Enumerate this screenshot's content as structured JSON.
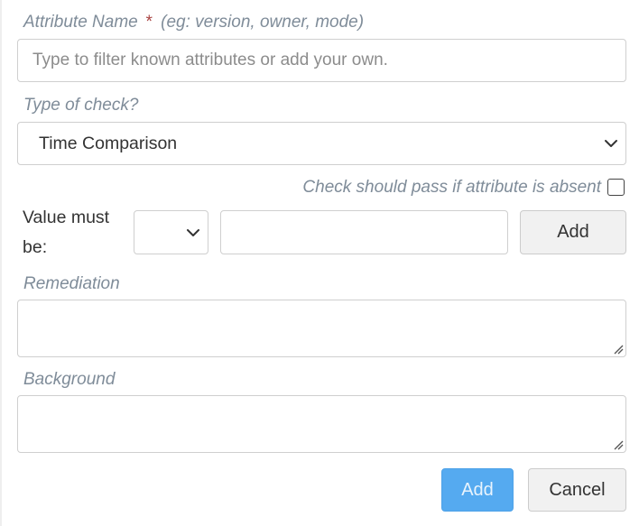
{
  "attribute_name": {
    "label": "Attribute Name",
    "required_mark": "*",
    "hint": "(eg: version, owner, mode)",
    "placeholder": "Type to filter known attributes or add your own.",
    "value": ""
  },
  "type_of_check": {
    "label": "Type of check?",
    "selected": "Time Comparison"
  },
  "absent_check": {
    "label": "Check should pass if attribute is absent",
    "checked": false
  },
  "value_must_be": {
    "label_line1": "Value must",
    "label_line2": "be:",
    "operator_selected": "",
    "value": "",
    "add_label": "Add"
  },
  "remediation": {
    "label": "Remediation",
    "value": ""
  },
  "background": {
    "label": "Background",
    "value": ""
  },
  "footer": {
    "add_label": "Add",
    "cancel_label": "Cancel"
  },
  "colors": {
    "label_muted": "#7f8c99",
    "required": "#a94442",
    "primary": "#55aaf0",
    "border": "#cfcfcf"
  },
  "icons": {
    "select_arrow": "chevron-down-icon",
    "textarea_resize": "resize-grip-icon"
  }
}
